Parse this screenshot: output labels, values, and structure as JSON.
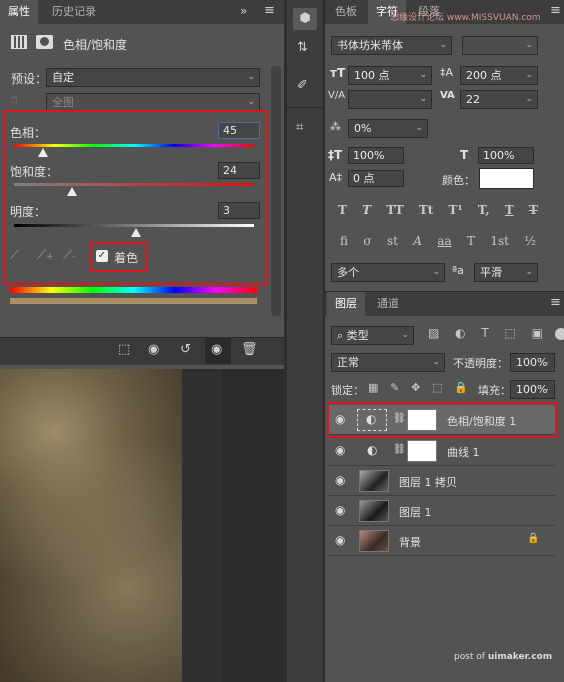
{
  "left_panel": {
    "tabs": [
      "属性",
      "历史记录"
    ],
    "collapse_icon": "double-chevron-icon",
    "menu_icon": "hamburger-icon",
    "adjustment_title": "色相/饱和度",
    "preset_label": "预设：",
    "preset_value": "自定",
    "channel_value": "全图",
    "hue": {
      "label": "色相：",
      "value": "45",
      "fraction": 0.12
    },
    "saturation": {
      "label": "饱和度：",
      "value": "24",
      "fraction": 0.24
    },
    "lightness": {
      "label": "明度：",
      "value": "3",
      "fraction": 0.51
    },
    "colorize_label": "着色",
    "colorize_checked": true,
    "highlight_color": "#e0141e",
    "tint_color": "#a89068"
  },
  "right_panel": {
    "top_tabs": [
      "色板",
      "字符",
      "段落"
    ],
    "font_family": "书体坊米芾体",
    "font_size": "100 点",
    "leading": "200 点",
    "kerning": "",
    "tracking": "22",
    "scale_label_value": "0%",
    "vscale": "100%",
    "hscale": "100%",
    "baseline": "0 点",
    "color_label": "颜色：",
    "language": "多个",
    "antialias_label": "aa",
    "antialias": "平滑",
    "type_buttons": [
      "T",
      "T",
      "TT",
      "Tt",
      "T¹",
      "T,",
      "T",
      "T"
    ],
    "opentype_buttons": [
      "fi",
      "σ",
      "st",
      "A",
      "aa",
      "T",
      "1st",
      "½"
    ],
    "watermark": "思缘设计论坛 www.MISSVUAN.com"
  },
  "layers_panel": {
    "tabs": [
      "图层",
      "通道"
    ],
    "filter_label": "类型",
    "blend_mode": "正常",
    "opacity_label": "不透明度：",
    "opacity": "100%",
    "lock_label": "锁定：",
    "fill_label": "填充：",
    "fill": "100%",
    "layers": [
      {
        "name": "色相/饱和度 1",
        "type": "adjustment",
        "selected": true
      },
      {
        "name": "曲线 1",
        "type": "adjustment",
        "selected": false
      },
      {
        "name": "图层 1 拷贝",
        "type": "image",
        "selected": false
      },
      {
        "name": "图层 1",
        "type": "image",
        "selected": false
      },
      {
        "name": "背景",
        "type": "image",
        "selected": false,
        "locked": true
      }
    ],
    "credit_prefix": "post of",
    "credit_site": "uimaker.com"
  }
}
